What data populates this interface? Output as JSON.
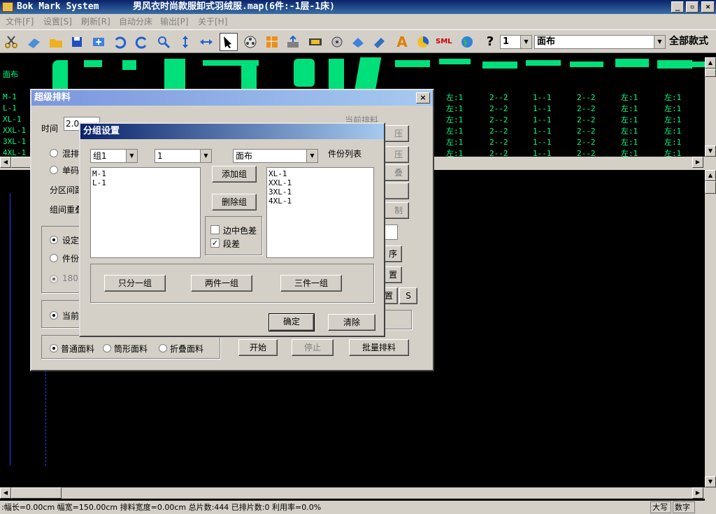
{
  "window": {
    "app_name": "Bok Mark System",
    "file_title": "男风衣时尚款服卸式羽绒服.map(6件:-1层-1床)"
  },
  "menu": [
    "文件[F]",
    "设置[S]",
    "刷新[R]",
    "自动分床",
    "输出[P]",
    "关于[H]"
  ],
  "toolbar": {
    "num_select": "1",
    "fabric_select": "面布",
    "style_select": "全部款式",
    "sml_label": "SML",
    "text_tool": "A",
    "help": "?"
  },
  "canvas_top": {
    "fabric_label": "面布",
    "sizes": [
      "M-1",
      "L-1",
      "XL-1",
      "XXL-1",
      "3XL-1",
      "4XL-1"
    ],
    "columns": [
      "左:1",
      "2--2",
      "1--1",
      "2--2",
      "左:1",
      "左:1"
    ]
  },
  "super_layout": {
    "title": "超级排料",
    "time_label": "时间",
    "time_value": "2.0",
    "current_label": "当前排料",
    "mixed_label": "混排",
    "single_code_label": "单码",
    "zone_spacing_label": "分区间距",
    "group_overlap_label": "组间重叠",
    "set_label": "设定",
    "piece_label": "件份",
    "deg_label": "180",
    "current_short": "当前",
    "right_buttons": [
      "压",
      "压",
      "叠",
      "",
      "制"
    ],
    "order_button": "序",
    "place_button": "置",
    "place2_button": "置",
    "s_button": "S",
    "normal_fabric": "普通面料",
    "tube_fabric": "筒形面料",
    "fold_fabric": "折叠面料",
    "start": "开始",
    "stop": "停止",
    "batch": "批量排料"
  },
  "group_dialog": {
    "title": "分组设置",
    "group_select": "组1",
    "num_select": "1",
    "fabric_select": "面布",
    "piece_list_label": "件份列表",
    "left_list": [
      "M-1",
      "L-1"
    ],
    "right_list": [
      "XL-1",
      "XXL-1",
      "3XL-1",
      "4XL-1"
    ],
    "add_group": "添加组",
    "delete_group": "删除组",
    "edge_color_diff": "边中色差",
    "edge_checked": false,
    "segment_diff": "段差",
    "segment_checked": true,
    "one_group": "只分一组",
    "two_per_group": "两件一组",
    "three_per_group": "三件一组",
    "ok": "确定",
    "clear": "清除"
  },
  "status": {
    "info": ":幅长=0.00cm 幅宽=150.00cm 排料宽度=0.00cm 总片数:444 已排片数:0 利用率=0.0%",
    "caps": "大写",
    "num": "数字"
  }
}
